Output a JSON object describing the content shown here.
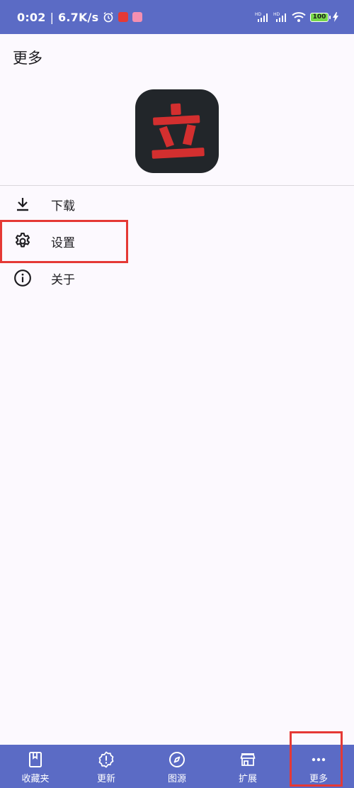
{
  "status_bar": {
    "time": "0:02",
    "separator": "|",
    "net_speed": "6.7K/s",
    "signal_label_1": "HD",
    "signal_label_2": "HD",
    "battery_level": "100"
  },
  "header": {
    "title": "更多"
  },
  "menu": {
    "items": [
      {
        "label": "下载",
        "icon": "download-icon"
      },
      {
        "label": "设置",
        "icon": "settings-gear-icon"
      },
      {
        "label": "关于",
        "icon": "info-icon"
      }
    ]
  },
  "logo": {
    "glyph": "立"
  },
  "bottom_nav": {
    "items": [
      {
        "label": "收藏夹",
        "icon": "bookmark-book-icon"
      },
      {
        "label": "更新",
        "icon": "alert-badge-icon"
      },
      {
        "label": "图源",
        "icon": "compass-icon"
      },
      {
        "label": "扩展",
        "icon": "store-icon"
      },
      {
        "label": "更多",
        "icon": "more-dots-icon"
      }
    ],
    "selected": "更多"
  },
  "colors": {
    "primary": "#5b6bc5",
    "background": "#fcf9fe",
    "highlight": "#e53935",
    "logo_bg": "#22262a",
    "logo_glyph": "#d32f2f"
  }
}
